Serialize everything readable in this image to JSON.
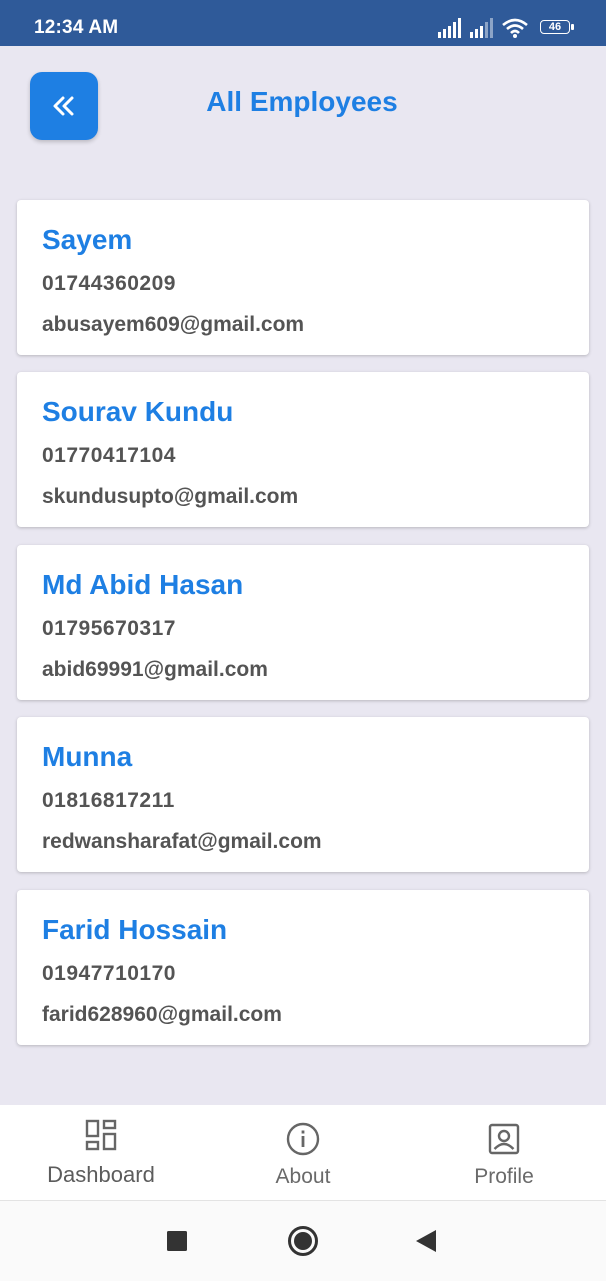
{
  "status_bar": {
    "time": "12:34 AM",
    "battery": "46",
    "icons": [
      "signal-icon",
      "signal-icon-2",
      "wifi-icon",
      "battery-icon"
    ]
  },
  "header": {
    "title": "All Employees",
    "back_icon": "double-chevron-left-icon"
  },
  "employees": [
    {
      "name": "Sayem",
      "phone": "01744360209",
      "email": "abusayem609@gmail.com"
    },
    {
      "name": "Sourav Kundu",
      "phone": "01770417104",
      "email": "skundusupto@gmail.com"
    },
    {
      "name": "Md Abid Hasan",
      "phone": "01795670317",
      "email": "abid69991@gmail.com"
    },
    {
      "name": "Munna",
      "phone": "01816817211",
      "email": "redwansharafat@gmail.com"
    },
    {
      "name": "Farid Hossain",
      "phone": "01947710170",
      "email": "farid628960@gmail.com"
    }
  ],
  "bottom_nav": {
    "items": [
      {
        "label": "Dashboard",
        "icon": "dashboard-icon"
      },
      {
        "label": "About",
        "icon": "info-icon"
      },
      {
        "label": "Profile",
        "icon": "profile-icon"
      }
    ]
  },
  "colors": {
    "accent": "#1e7fe3",
    "status_bar": "#2f5a99",
    "background": "#e9e7f1",
    "text_secondary": "#545454"
  }
}
